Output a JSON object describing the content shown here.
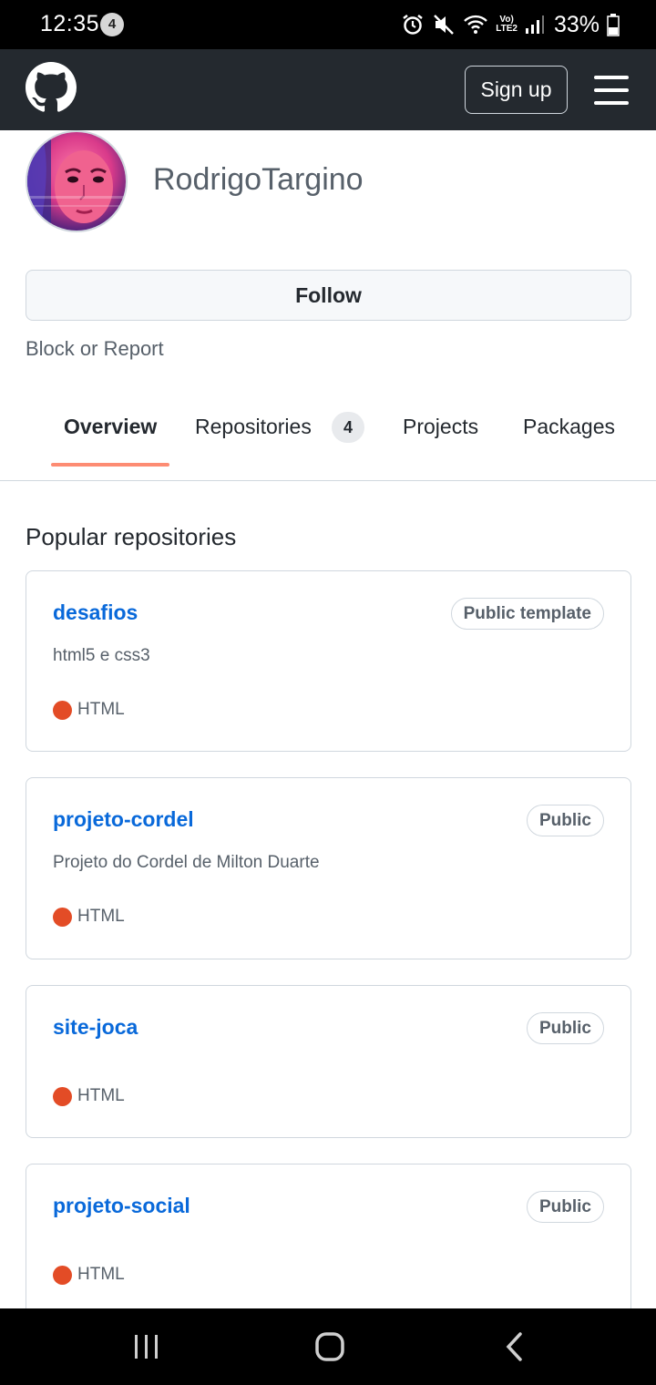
{
  "status_bar": {
    "time": "12:35",
    "notification_count": "4",
    "network": "LTE2",
    "battery": "33%"
  },
  "header": {
    "logo_icon": "github-mark-icon",
    "signup_label": "Sign up",
    "menu_icon": "hamburger-menu-icon"
  },
  "profile": {
    "username": "RodrigoTargino",
    "follow_label": "Follow",
    "block_report_label": "Block or Report"
  },
  "tabs": [
    {
      "label": "Overview",
      "active": true
    },
    {
      "label": "Repositories",
      "count": "4"
    },
    {
      "label": "Projects"
    },
    {
      "label": "Packages"
    }
  ],
  "popular": {
    "title": "Popular repositories",
    "repos": [
      {
        "name": "desafios",
        "visibility": "Public template",
        "description": "html5 e css3",
        "language": "HTML"
      },
      {
        "name": "projeto-cordel",
        "visibility": "Public",
        "description": "Projeto do Cordel de Milton Duarte",
        "language": "HTML"
      },
      {
        "name": "site-joca",
        "visibility": "Public",
        "description": "",
        "language": "HTML"
      },
      {
        "name": "projeto-social",
        "visibility": "Public",
        "description": "",
        "language": "HTML"
      }
    ]
  },
  "colors": {
    "header_bg": "#24292f",
    "link": "#0969da",
    "tab_underline": "#fd8c73",
    "html_language": "#e34c26"
  },
  "nav_bar": {
    "recent_icon": "recent-apps-icon",
    "home_icon": "home-icon",
    "back_icon": "back-icon"
  }
}
